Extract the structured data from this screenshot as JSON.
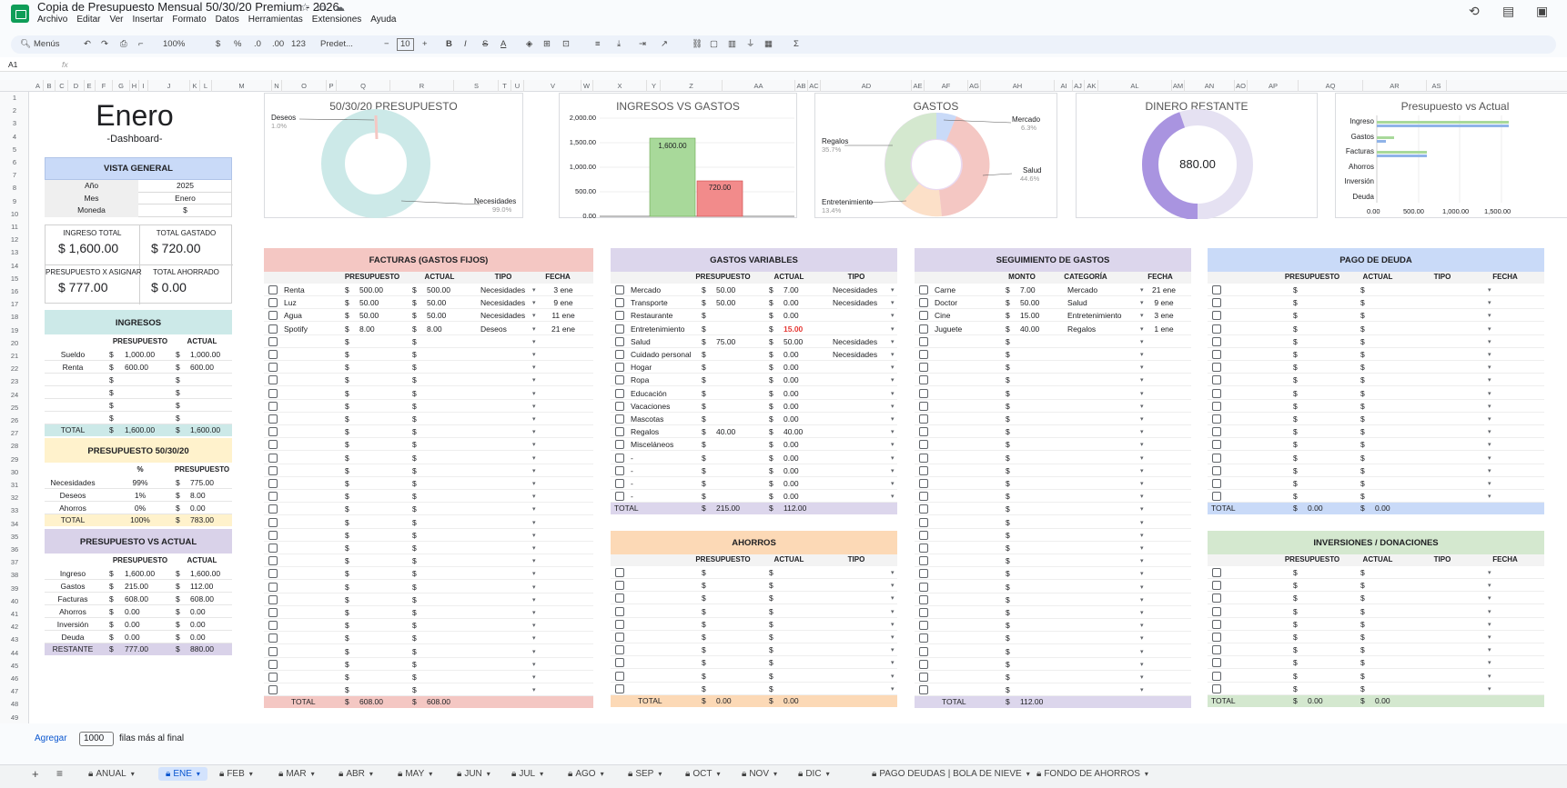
{
  "app": {
    "title": "Copia de Presupuesto Mensual 50/30/20 Premium - 2026"
  },
  "menu": [
    "Archivo",
    "Editar",
    "Ver",
    "Insertar",
    "Formato",
    "Datos",
    "Herramientas",
    "Extensiones",
    "Ayuda"
  ],
  "toolbar": {
    "search": "Menús",
    "zoom": "100%",
    "currency": "$",
    "percent": "%",
    "dec_down": ".0",
    "dec_up": ".00",
    "num_fmt": "123",
    "font": "Predet...",
    "font_size": "10",
    "bold": "B",
    "italic": "I",
    "strike": "S",
    "text_color": "A",
    "sigma": "Σ",
    "minus": "−",
    "plus": "+"
  },
  "formula": {
    "cell_ref": "A1",
    "fx": "fx"
  },
  "columns": [
    "A",
    "B",
    "C",
    "D",
    "E",
    "F",
    "G",
    "H",
    "I",
    "J",
    "K",
    "L",
    "M",
    "N",
    "O",
    "P",
    "Q",
    "R",
    "S",
    "T",
    "U",
    "V",
    "W",
    "X",
    "Y",
    "Z",
    "AA",
    "AB",
    "AC",
    "AD",
    "AE",
    "AF",
    "AG",
    "AH",
    "AI",
    "AJ",
    "AK",
    "AL",
    "AM",
    "AN",
    "AO",
    "AP",
    "AQ",
    "AR",
    "AS"
  ],
  "rows_first": 1,
  "rows_last": 49,
  "dashboard": {
    "month": "Enero",
    "subtitle": "-Dashboard-"
  },
  "general": {
    "header": "VISTA GENERAL",
    "rows": [
      [
        "Año",
        "2025"
      ],
      [
        "Mes",
        "Enero"
      ],
      [
        "Moneda",
        "$"
      ]
    ]
  },
  "summary": {
    "ingreso_label": "INGRESO TOTAL",
    "ingreso": "$   1,600.00",
    "gastado_label": "TOTAL GASTADO",
    "gastado": "$   720.00",
    "asignar_label": "PRESUPUESTO X ASIGNAR",
    "asignar": "$   777.00",
    "ahorrado_label": "TOTAL AHORRADO",
    "ahorrado": "$   0.00"
  },
  "ingresos": {
    "header": "INGRESOS",
    "col1": "PRESUPUESTO",
    "col2": "ACTUAL",
    "rows": [
      [
        "Sueldo",
        "1,000.00",
        "1,000.00"
      ],
      [
        "Renta",
        "600.00",
        "600.00"
      ],
      [
        "",
        "",
        ""
      ],
      [
        "",
        "",
        ""
      ],
      [
        "",
        "",
        ""
      ],
      [
        "",
        "",
        ""
      ]
    ],
    "total": [
      "TOTAL",
      "1,600.00",
      "1,600.00"
    ]
  },
  "p503020": {
    "header": "PRESUPUESTO 50/30/20",
    "col1": "%",
    "col2": "PRESUPUESTO",
    "rows": [
      [
        "Necesidades",
        "99%",
        "775.00"
      ],
      [
        "Deseos",
        "1%",
        "8.00"
      ],
      [
        "Ahorros",
        "0%",
        "0.00"
      ]
    ],
    "total": [
      "TOTAL",
      "100%",
      "783.00"
    ]
  },
  "pva": {
    "header": "PRESUPUESTO VS ACTUAL",
    "col1": "PRESUPUESTO",
    "col2": "ACTUAL",
    "rows": [
      [
        "Ingreso",
        "1,600.00",
        "1,600.00"
      ],
      [
        "Gastos",
        "215.00",
        "112.00"
      ],
      [
        "Facturas",
        "608.00",
        "608.00"
      ],
      [
        "Ahorros",
        "0.00",
        "0.00"
      ],
      [
        "Inversión",
        "0.00",
        "0.00"
      ],
      [
        "Deuda",
        "0.00",
        "0.00"
      ]
    ],
    "total": [
      "RESTANTE",
      "777.00",
      "880.00"
    ]
  },
  "charts": {
    "c1": {
      "title": "50/30/20 PRESUPUESTO",
      "l1": "Deseos",
      "p1": "1.0%",
      "l2": "Necesidades",
      "p2": "99.0%"
    },
    "c2": {
      "title": "INGRESOS VS GASTOS",
      "ticks": [
        "2,000.00",
        "1,500.00",
        "1,000.00",
        "500.00",
        "0.00"
      ],
      "bar1": "1,600.00",
      "bar2": "720.00"
    },
    "c3": {
      "title": "GASTOS",
      "l1": "Mercado",
      "p1": "6.3%",
      "l2": "Regalos",
      "p2": "35.7%",
      "l3": "Salud",
      "p3": "44.6%",
      "l4": "Entretenimiento",
      "p4": "13.4%"
    },
    "c4": {
      "title": "DINERO RESTANTE",
      "value": "880.00"
    },
    "c5": {
      "title": "Presupuesto vs Actual",
      "cats": [
        "Ingreso",
        "Gastos",
        "Facturas",
        "Ahorros",
        "Inversión",
        "Deuda"
      ],
      "ticks": [
        "0.00",
        "500.00",
        "1,000.00",
        "1,500.00"
      ]
    }
  },
  "facturas": {
    "header": "FACTURAS (GASTOS FIJOS)",
    "cols": [
      "PRESUPUESTO",
      "ACTUAL",
      "TIPO",
      "FECHA"
    ],
    "rows": [
      [
        "Renta",
        "500.00",
        "500.00",
        "Necesidades",
        "3 ene"
      ],
      [
        "Luz",
        "50.00",
        "50.00",
        "Necesidades",
        "9 ene"
      ],
      [
        "Agua",
        "50.00",
        "50.00",
        "Necesidades",
        "11 ene"
      ],
      [
        "Spotify",
        "8.00",
        "8.00",
        "Deseos",
        "21 ene"
      ]
    ],
    "total": [
      "TOTAL",
      "608.00",
      "608.00"
    ]
  },
  "variables": {
    "header": "GASTOS VARIABLES",
    "cols": [
      "PRESUPUESTO",
      "ACTUAL",
      "TIPO"
    ],
    "rows": [
      [
        "Mercado",
        "50.00",
        "7.00",
        "Necesidades"
      ],
      [
        "Transporte",
        "50.00",
        "0.00",
        "Necesidades"
      ],
      [
        "Restaurante",
        "",
        "0.00",
        ""
      ],
      [
        "Entretenimiento",
        "",
        "15.00",
        ""
      ],
      [
        "Salud",
        "75.00",
        "50.00",
        "Necesidades"
      ],
      [
        "Cuidado personal",
        "",
        "0.00",
        "Necesidades"
      ],
      [
        "Hogar",
        "",
        "0.00",
        ""
      ],
      [
        "Ropa",
        "",
        "0.00",
        ""
      ],
      [
        "Educación",
        "",
        "0.00",
        ""
      ],
      [
        "Vacaciones",
        "",
        "0.00",
        ""
      ],
      [
        "Mascotas",
        "",
        "0.00",
        ""
      ],
      [
        "Regalos",
        "40.00",
        "40.00",
        ""
      ],
      [
        "Misceláneos",
        "",
        "0.00",
        ""
      ],
      [
        "-",
        "",
        "0.00",
        ""
      ],
      [
        "-",
        "",
        "0.00",
        ""
      ],
      [
        "-",
        "",
        "0.00",
        ""
      ],
      [
        "-",
        "",
        "0.00",
        ""
      ]
    ],
    "total": [
      "TOTAL",
      "215.00",
      "112.00"
    ]
  },
  "ahorros": {
    "header": "AHORROS",
    "cols": [
      "PRESUPUESTO",
      "ACTUAL",
      "TIPO"
    ],
    "total": [
      "TOTAL",
      "0.00",
      "0.00"
    ]
  },
  "seguimiento": {
    "header": "SEGUIMIENTO DE GASTOS",
    "cols": [
      "MONTO",
      "CATEGORÍA",
      "FECHA"
    ],
    "rows": [
      [
        "Carne",
        "7.00",
        "Mercado",
        "21 ene"
      ],
      [
        "Doctor",
        "50.00",
        "Salud",
        "9 ene"
      ],
      [
        "Cine",
        "15.00",
        "Entretenimiento",
        "3 ene"
      ],
      [
        "Juguete",
        "40.00",
        "Regalos",
        "1 ene"
      ]
    ],
    "total": [
      "TOTAL",
      "112.00"
    ]
  },
  "deuda": {
    "header": "PAGO DE DEUDA",
    "cols": [
      "PRESUPUESTO",
      "ACTUAL",
      "TIPO",
      "FECHA"
    ],
    "total": [
      "TOTAL",
      "0.00",
      "0.00"
    ]
  },
  "inversiones": {
    "header": "INVERSIONES / DONACIONES",
    "cols": [
      "PRESUPUESTO",
      "ACTUAL",
      "TIPO",
      "FECHA"
    ],
    "total": [
      "TOTAL",
      "0.00",
      "0.00"
    ]
  },
  "bottom": {
    "add": "Agregar",
    "count": "1000",
    "suffix": "filas más al final"
  },
  "tabs": [
    "ANUAL",
    "ENE",
    "FEB",
    "MAR",
    "ABR",
    "MAY",
    "JUN",
    "JUL",
    "AGO",
    "SEP",
    "OCT",
    "NOV",
    "DIC",
    "PAGO DEUDAS | BOLA DE NIEVE",
    "FONDO DE AHORROS"
  ],
  "colors": {
    "blue": "#c9daf8",
    "teal": "#cce9e8",
    "yellow": "#fff2cc",
    "purple": "#d9d2e9",
    "pink": "#f4c7c3",
    "lilac": "#dcd6ec",
    "peach": "#fcd9b6",
    "green": "#d4e8cf"
  }
}
